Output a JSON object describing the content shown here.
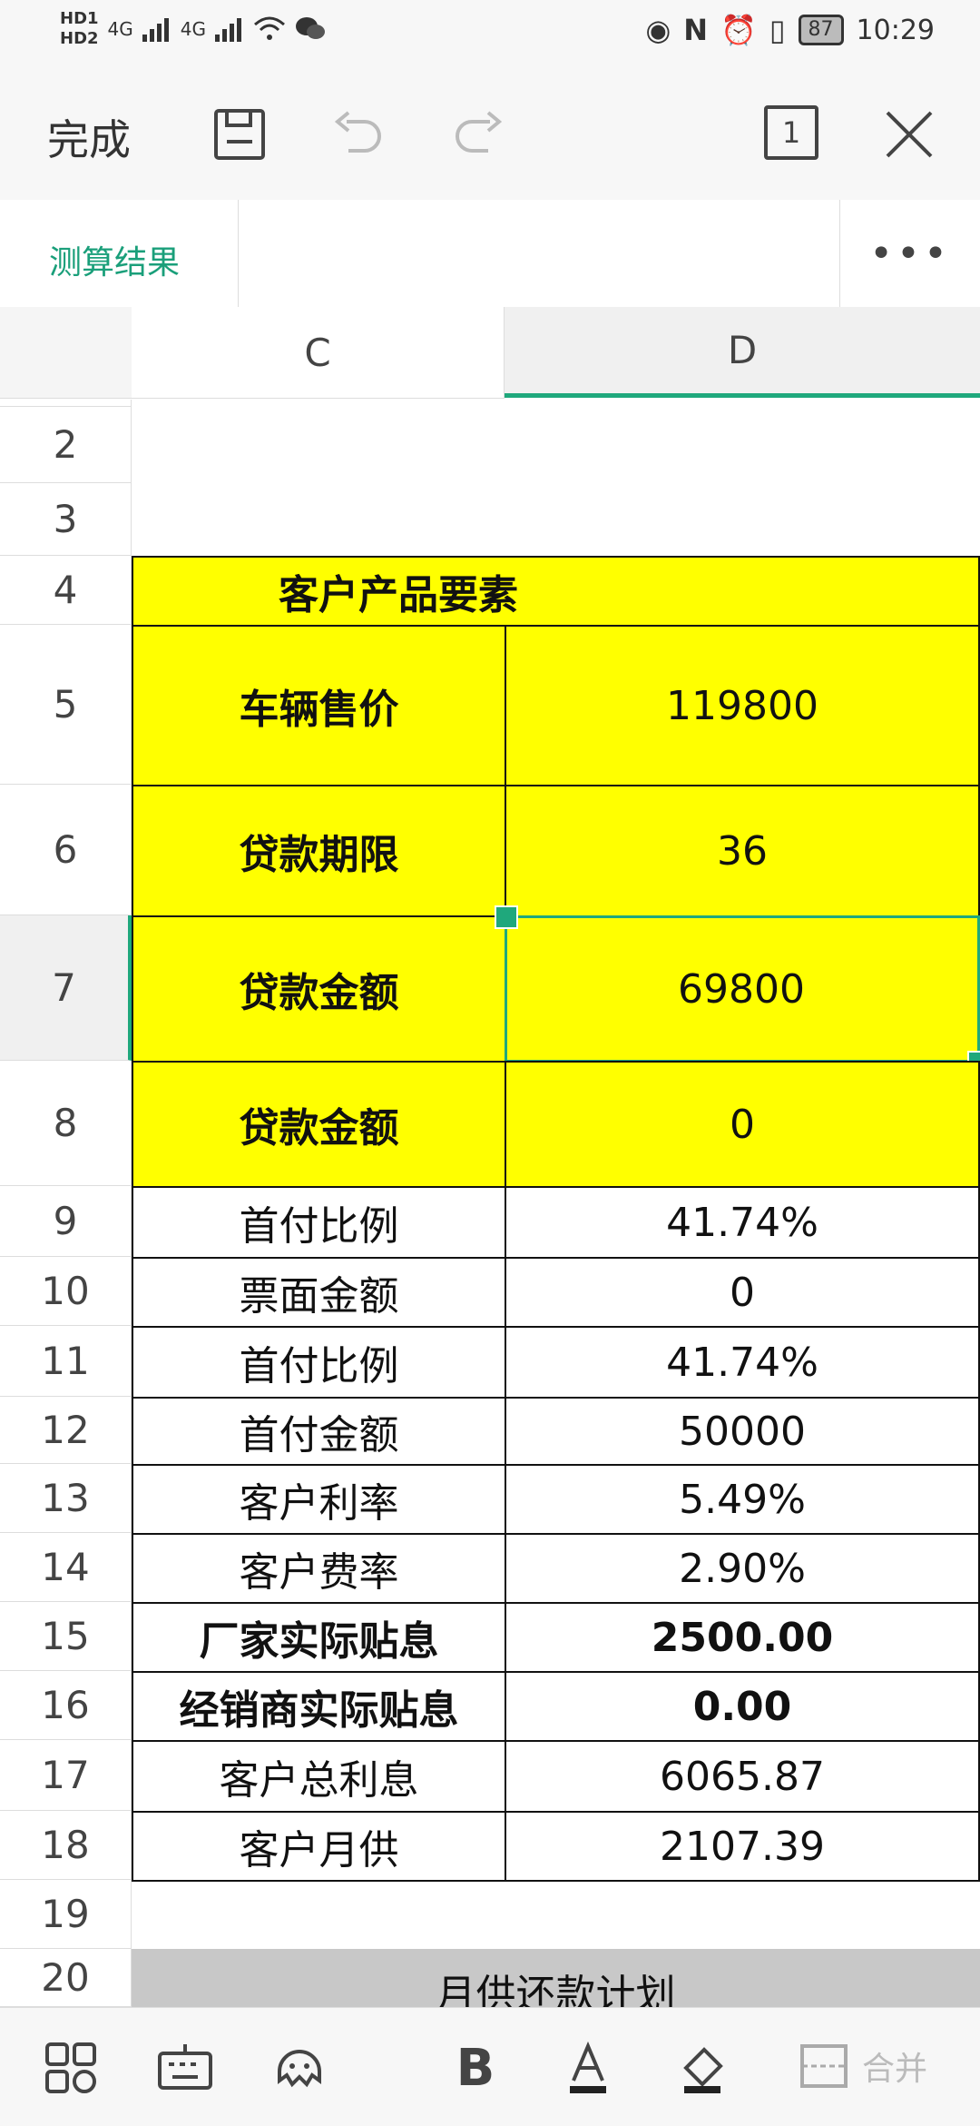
{
  "status": {
    "left": [
      "HD1",
      "HD2",
      "4G",
      "4G"
    ],
    "battery": "87",
    "time": "10:29"
  },
  "toolbar": {
    "done_label": "完成",
    "page_count": "1"
  },
  "sheet": {
    "tab_label": "测算结果",
    "more_label": "•••",
    "columns": [
      "C",
      "D"
    ]
  },
  "rows": {
    "r2": "2",
    "r3": "3",
    "r4": "4",
    "r5": "5",
    "r6": "6",
    "r7": "7",
    "r8": "8",
    "r9": "9",
    "r10": "10",
    "r11": "11",
    "r12": "12",
    "r13": "13",
    "r14": "14",
    "r15": "15",
    "r16": "16",
    "r17": "17",
    "r18": "18",
    "r19": "19",
    "r20": "20"
  },
  "table": {
    "header": "客户产品要素",
    "r5": {
      "label": "车辆售价",
      "value": "119800"
    },
    "r6": {
      "label": "贷款期限",
      "value": "36"
    },
    "r7": {
      "label": "贷款金额",
      "value": "69800"
    },
    "r8": {
      "label": "贷款金额",
      "value": "0"
    },
    "r9": {
      "label": "首付比例",
      "value": "41.74%"
    },
    "r10": {
      "label": "票面金额",
      "value": "0"
    },
    "r11": {
      "label": "首付比例",
      "value": "41.74%"
    },
    "r12": {
      "label": "首付金额",
      "value": "50000"
    },
    "r13": {
      "label": "客户利率",
      "value": "5.49%"
    },
    "r14": {
      "label": "客户费率",
      "value": "2.90%"
    },
    "r15": {
      "label": "厂家实际贴息",
      "value": "2500.00"
    },
    "r16": {
      "label": "经销商实际贴息",
      "value": "0.00"
    },
    "r17": {
      "label": "客户总利息",
      "value": "6065.87"
    },
    "r18": {
      "label": "客户月供",
      "value": "2107.39"
    },
    "r20": "月供还款计划"
  },
  "bottom": {
    "merge_label": "合并"
  },
  "colors": {
    "accent": "#1fa87c",
    "highlight": "#ffff00",
    "section_gray": "#c8c8c8"
  }
}
